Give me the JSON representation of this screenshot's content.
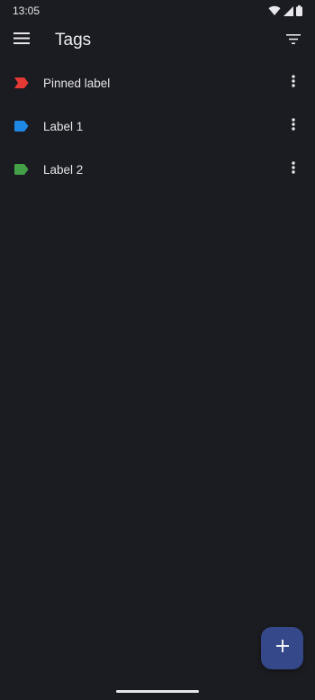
{
  "status_bar": {
    "time": "13:05",
    "icons": [
      "wifi-icon",
      "signal-icon",
      "battery-icon"
    ]
  },
  "app_bar": {
    "title": "Tags",
    "menu_icon": "hamburger-menu-icon",
    "filter_icon": "filter-icon"
  },
  "tags": [
    {
      "label": "Pinned label",
      "icon": "pinned-tag-icon",
      "color": "#e53935"
    },
    {
      "label": "Label 1",
      "icon": "tag-icon",
      "color": "#1e88e5"
    },
    {
      "label": "Label 2",
      "icon": "tag-icon",
      "color": "#43a047"
    }
  ],
  "fab": {
    "icon": "plus-icon",
    "color": "#34488a"
  },
  "colors": {
    "background": "#1b1c21",
    "text": "#e6e6ea"
  }
}
